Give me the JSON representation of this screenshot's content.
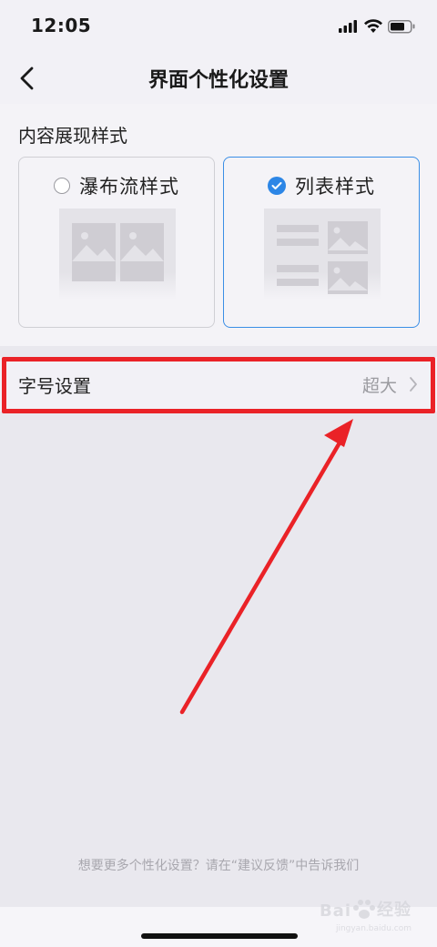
{
  "status_bar": {
    "time": "12:05"
  },
  "nav": {
    "title": "界面个性化设置"
  },
  "content_style": {
    "section_title": "内容展现样式",
    "options": [
      {
        "label": "瀑布流样式",
        "selected": false
      },
      {
        "label": "列表样式",
        "selected": true
      }
    ]
  },
  "font_setting": {
    "label": "字号设置",
    "value": "超大"
  },
  "footer": {
    "hint": "想要更多个性化设置？请在“建议反馈”中告诉我们"
  },
  "watermark": {
    "brand": "Bai",
    "suffix": "经验",
    "url": "jingyan.baidu.com"
  },
  "colors": {
    "accent_blue": "#2c86e6",
    "annotation_red": "#ea2227",
    "background": "#e9e8ee"
  }
}
